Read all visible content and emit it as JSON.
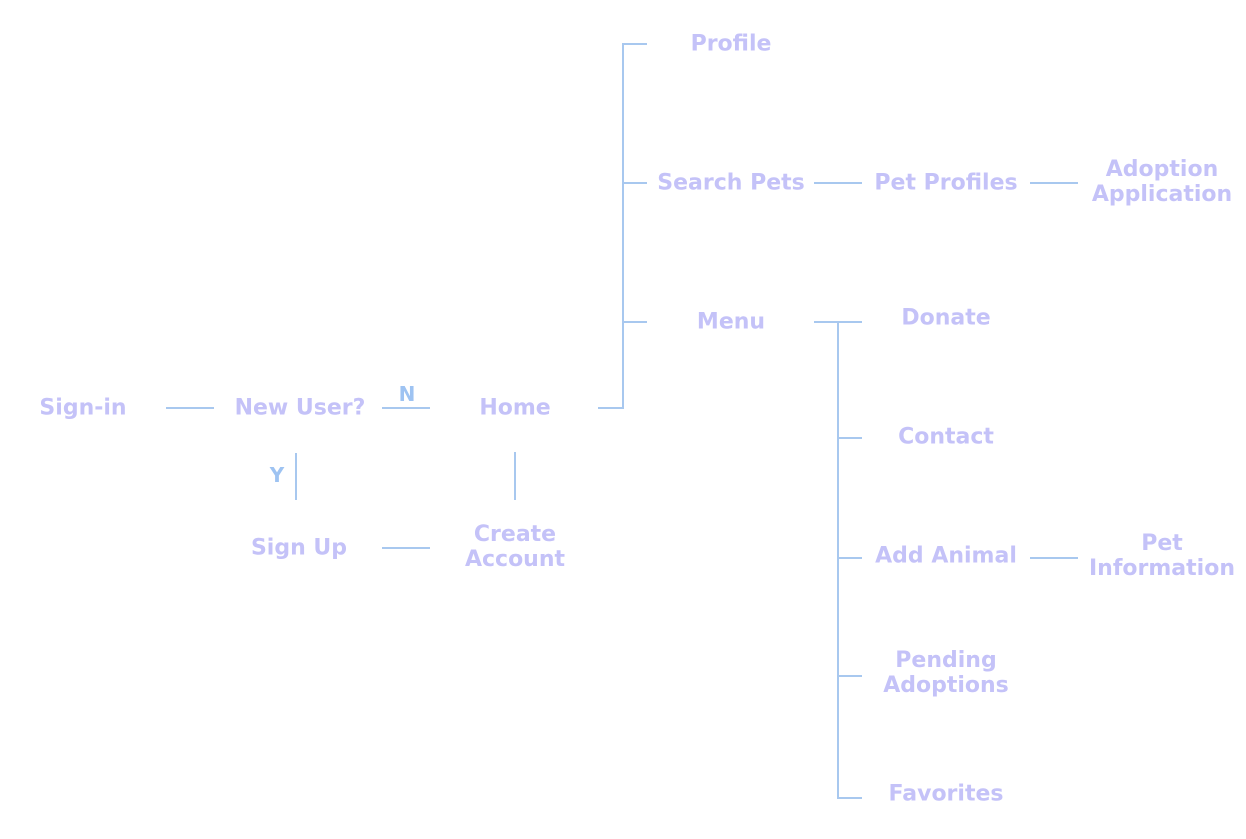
{
  "colors": {
    "node_text": "#c4c2f8",
    "edge_label_text": "#9ec3f2",
    "connector": "#a8c8ef",
    "background": "#ffffff"
  },
  "nodes": {
    "sign_in": "Sign-in",
    "new_user": "New User?",
    "home": "Home",
    "sign_up": "Sign Up",
    "create_account": [
      "Create",
      "Account"
    ],
    "profile": "Profile",
    "search_pets": "Search Pets",
    "pet_profiles": "Pet Profiles",
    "adoption_application": [
      "Adoption",
      "Application"
    ],
    "menu": "Menu",
    "donate": "Donate",
    "contact": "Contact",
    "add_animal": "Add Animal",
    "pet_information": [
      "Pet",
      "Information"
    ],
    "pending_adoptions": [
      "Pending",
      "Adoptions"
    ],
    "favorites": "Favorites"
  },
  "edge_labels": {
    "no": "N",
    "yes": "Y"
  }
}
